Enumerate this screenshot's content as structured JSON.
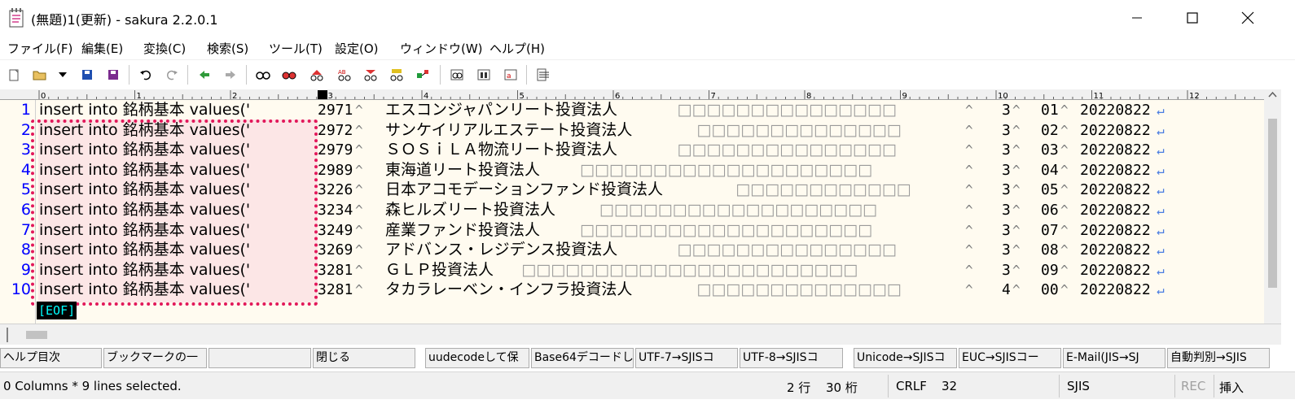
{
  "window": {
    "title": "(無題)1(更新) - sakura 2.2.0.1",
    "app_icon": "notepad-icon",
    "controls": [
      "minimize-icon",
      "maximize-icon",
      "close-icon"
    ]
  },
  "menu": {
    "items": [
      "ファイル(F)",
      "編集(E)",
      "変換(C)",
      "検索(S)",
      "ツール(T)",
      "設定(O)",
      "ウィンドウ(W)",
      "ヘルプ(H)"
    ]
  },
  "toolbar": {
    "icons": [
      "new-file-icon",
      "open-file-icon",
      "dropdown-arrow-icon",
      "save-icon",
      "save-as-icon",
      "undo-icon",
      "redo-icon",
      "jump-back-icon",
      "jump-forward-icon",
      "search-icon",
      "search-next-icon",
      "search-prev-icon",
      "replace-icon",
      "grep-icon",
      "grep-replace-icon",
      "tag-jump-icon",
      "compare-icon",
      "settings-icon",
      "font-icon",
      "outline-icon"
    ]
  },
  "ruler": {
    "labels": [
      "0",
      "1",
      "2",
      "3",
      "4",
      "5",
      "6",
      "7",
      "8",
      "9",
      "10",
      "11",
      "12"
    ]
  },
  "editor": {
    "line_numbers": [
      "1",
      "2",
      "3",
      "4",
      "5",
      "6",
      "7",
      "8",
      "9",
      "10"
    ],
    "lines": [
      {
        "prefix": "insert into 銘柄基本 values('",
        "code": "2971",
        "name": "エスコンジャパンリート投資法人",
        "pad": "□□□□□□□□□□□□□□□",
        "f1": "3",
        "f2": "01",
        "date": "20220822"
      },
      {
        "prefix": "insert into 銘柄基本 values('",
        "code": "2972",
        "name": "サンケイリアルエステート投資法人",
        "pad": "□□□□□□□□□□□□□□",
        "f1": "3",
        "f2": "02",
        "date": "20220822"
      },
      {
        "prefix": "insert into 銘柄基本 values('",
        "code": "2979",
        "name": "ＳＯＳｉＬＡ物流リート投資法人",
        "pad": "□□□□□□□□□□□□□□□",
        "f1": "3",
        "f2": "03",
        "date": "20220822"
      },
      {
        "prefix": "insert into 銘柄基本 values('",
        "code": "2989",
        "name": "東海道リート投資法人",
        "pad": "□□□□□□□□□□□□□□□□□□□□",
        "f1": "3",
        "f2": "04",
        "date": "20220822"
      },
      {
        "prefix": "insert into 銘柄基本 values('",
        "code": "3226",
        "name": "日本アコモデーションファンド投資法人",
        "pad": "□□□□□□□□□□□□",
        "f1": "3",
        "f2": "05",
        "date": "20220822"
      },
      {
        "prefix": "insert into 銘柄基本 values('",
        "code": "3234",
        "name": "森ヒルズリート投資法人",
        "pad": "□□□□□□□□□□□□□□□□□□□",
        "f1": "3",
        "f2": "06",
        "date": "20220822"
      },
      {
        "prefix": "insert into 銘柄基本 values('",
        "code": "3249",
        "name": "産業ファンド投資法人",
        "pad": "□□□□□□□□□□□□□□□□□□□□",
        "f1": "3",
        "f2": "07",
        "date": "20220822"
      },
      {
        "prefix": "insert into 銘柄基本 values('",
        "code": "3269",
        "name": "アドバンス・レジデンス投資法人",
        "pad": "□□□□□□□□□□□□□□□",
        "f1": "3",
        "f2": "08",
        "date": "20220822"
      },
      {
        "prefix": "insert into 銘柄基本 values('",
        "code": "3281",
        "name": "ＧＬＰ投資法人",
        "pad": "□□□□□□□□□□□□□□□□□□□□□□□",
        "f1": "3",
        "f2": "09",
        "date": "20220822"
      },
      {
        "prefix": "insert into 銘柄基本 values('",
        "code": "3281",
        "name": "タカラレーベン・インフラ投資法人",
        "pad": "□□□□□□□□□□□□□□",
        "f1": "4",
        "f2": "00",
        "date": "20220822"
      }
    ],
    "tab_mark": "^",
    "cr_mark": "↵",
    "eof": "[EOF]",
    "selection_color": "#e2185a",
    "line_number_color": "#0000ff",
    "background": "#fffbf0"
  },
  "fkeys": [
    "ヘルプ目次",
    "ブックマークの一",
    "",
    "閉じる",
    "uudecodeして保",
    "Base64デコードし",
    "UTF-7→SJISコ",
    "UTF-8→SJISコ",
    "Unicode→SJISコ",
    "EUC→SJISコー",
    "E-Mail(JIS→SJ",
    "自動判別→SJIS"
  ],
  "status": {
    "message": "0 Columns * 9 lines selected.",
    "row": "2 行",
    "col": "30 桁",
    "eol": "CRLF",
    "code": "32",
    "encoding": "SJIS",
    "rec": "REC",
    "mode": "挿入"
  }
}
